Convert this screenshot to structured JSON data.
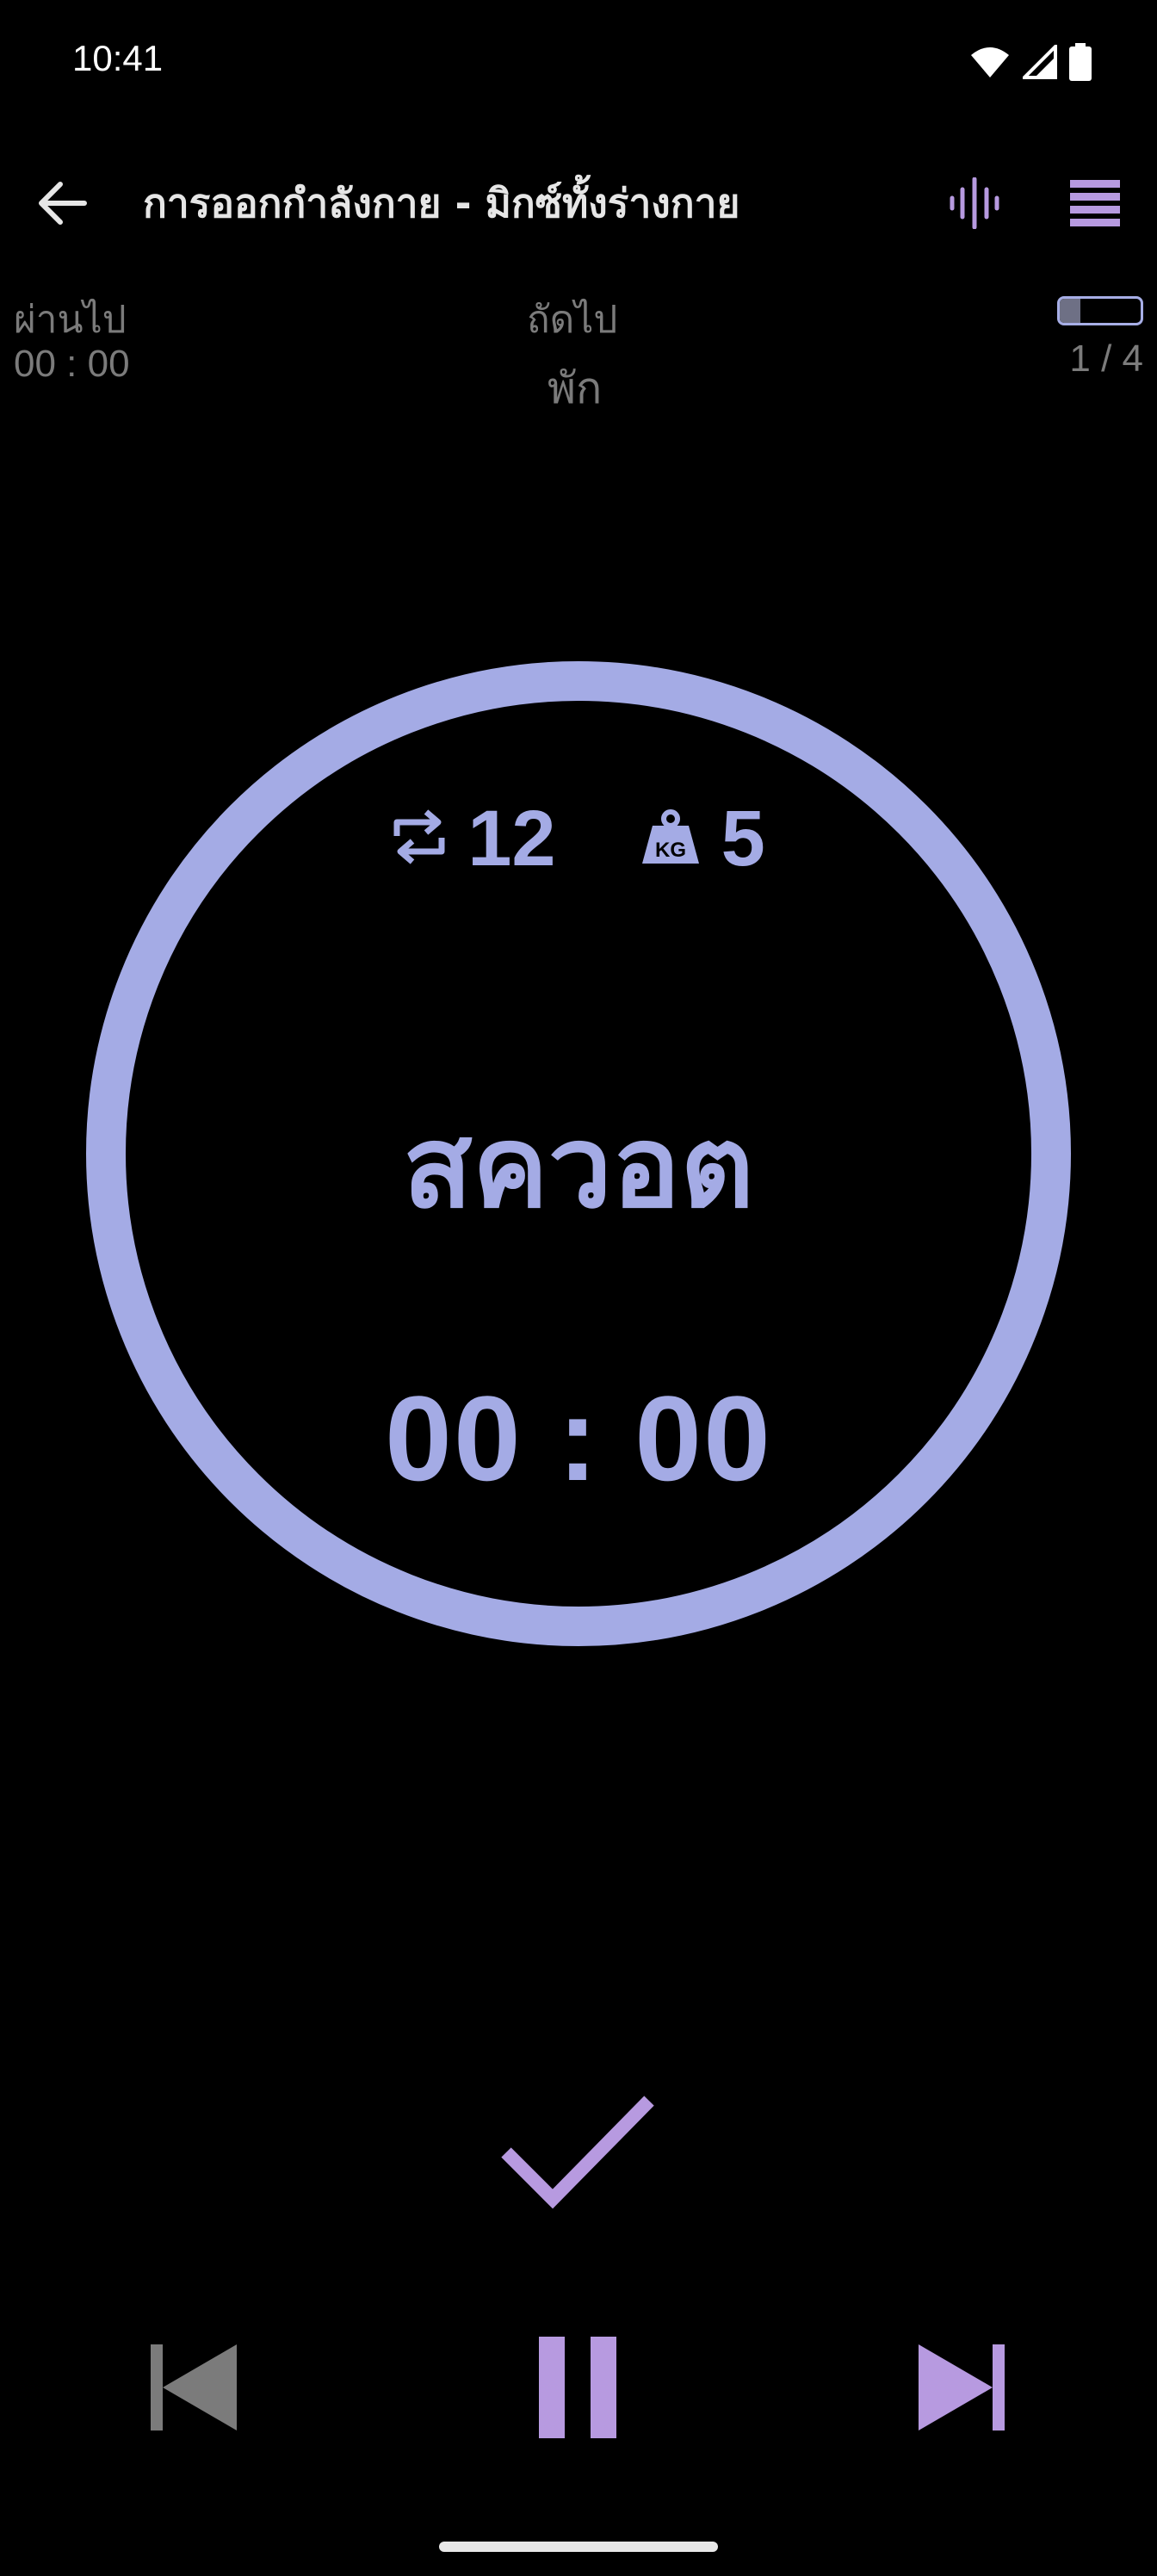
{
  "status_bar": {
    "time": "10:41",
    "icons": [
      "wifi-icon",
      "signal-icon",
      "battery-icon"
    ]
  },
  "app_bar": {
    "title": "การออกกำลังกาย - มิกซ์ทั้งร่างกาย",
    "back_icon": "arrow-left-icon",
    "audio_icon": "audio-waveform-icon",
    "menu_icon": "menu-icon"
  },
  "info": {
    "elapsed_label": "ผ่านไป",
    "elapsed_value": "00 : 00",
    "next_label": "ถัดไป",
    "next_value": "พัก",
    "progress_text": "1 / 4",
    "progress_fraction": 0.25
  },
  "exercise": {
    "reps": "12",
    "weight": "5",
    "name": "สควอต",
    "timer": "00 : 00"
  },
  "controls": {
    "done_icon": "checkmark-icon",
    "prev_icon": "skip-previous-icon",
    "pause_icon": "pause-icon",
    "next_icon": "skip-next-icon"
  },
  "colors": {
    "accent": "#a4abe5",
    "purple": "#b79ae0",
    "muted": "#7b7b7b",
    "background": "#000000"
  }
}
